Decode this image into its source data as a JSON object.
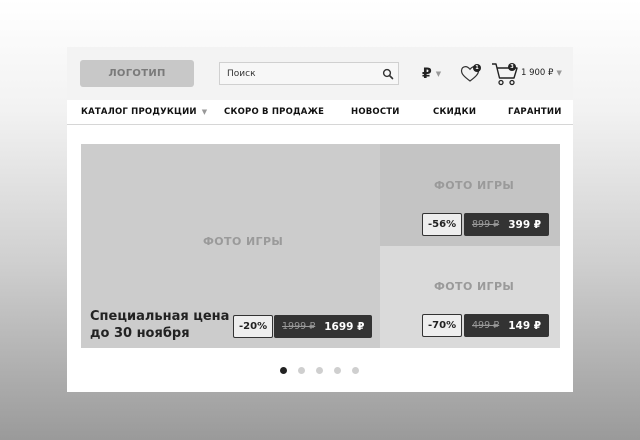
{
  "header": {
    "logo_label": "ЛОГОТИП",
    "search_placeholder": "Поиск",
    "currency_symbol": "₽",
    "favorites_count": "1",
    "cart_count": "3",
    "cart_total": "1 900 ₽"
  },
  "nav": {
    "items": [
      {
        "label": "КАТАЛОГ ПРОДУКЦИИ",
        "has_dropdown": true
      },
      {
        "label": "СКОРО В ПРОДАЖЕ"
      },
      {
        "label": "НОВОСТИ"
      },
      {
        "label": "СКИДКИ"
      },
      {
        "label": "ГАРАНТИИ"
      }
    ]
  },
  "slider": {
    "tiles": [
      {
        "photo_label": "ФОТО ИГРЫ",
        "promo_line1": "Специальная цена",
        "promo_line2": "до 30 ноября",
        "discount": "-20%",
        "old_price": "1999 ₽",
        "new_price": "1699 ₽"
      },
      {
        "photo_label": "ФОТО ИГРЫ",
        "discount": "-56%",
        "old_price": "899 ₽",
        "new_price": "399 ₽"
      },
      {
        "photo_label": "ФОТО ИГРЫ",
        "discount": "-70%",
        "old_price": "499 ₽",
        "new_price": "149 ₽"
      }
    ],
    "dots_total": 5,
    "active_dot": 1
  },
  "colors": {
    "accent_dark": "#333333",
    "tile_gray": "#cccccc",
    "topbar_bg": "#f3f3f3"
  }
}
